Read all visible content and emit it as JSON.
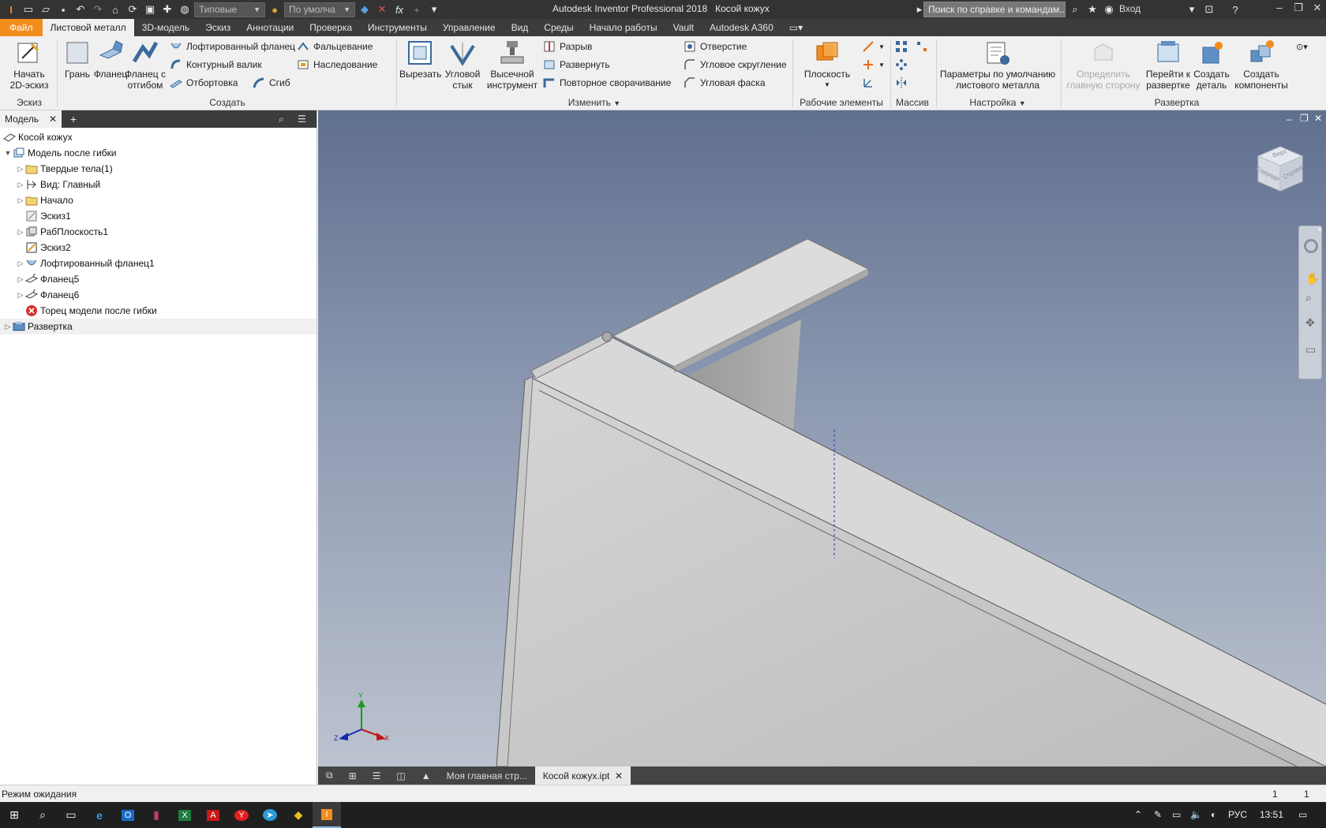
{
  "window": {
    "app_title": "Autodesk Inventor Professional 2018",
    "doc_title": "Косой кожух",
    "help_search_placeholder": "Поиск по справке и командам...",
    "signin": "Вход",
    "appearance_combo": "Типовые",
    "material_combo": "По умолча"
  },
  "tabs": [
    {
      "label": "Файл"
    },
    {
      "label": "Листовой металл"
    },
    {
      "label": "3D-модель"
    },
    {
      "label": "Эскиз"
    },
    {
      "label": "Аннотации"
    },
    {
      "label": "Проверка"
    },
    {
      "label": "Инструменты"
    },
    {
      "label": "Управление"
    },
    {
      "label": "Вид"
    },
    {
      "label": "Среды"
    },
    {
      "label": "Начало работы"
    },
    {
      "label": "Vault"
    },
    {
      "label": "Autodesk A360"
    }
  ],
  "ribbon": {
    "sketch": {
      "start_sketch_l1": "Начать",
      "start_sketch_l2": "2D-эскиз",
      "label": "Эскиз"
    },
    "create": {
      "face": "Грань",
      "flange": "Фланец",
      "contour_flange_l1": "Фланец с",
      "contour_flange_l2": "отгибом",
      "lofted_flange": "Лофтированный фланец",
      "contour_roll": "Контурный валик",
      "hem": "Отбортовка",
      "fold": "Фальцевание",
      "derive": "Наследование",
      "bend": "Сгиб",
      "label": "Создать"
    },
    "modify": {
      "cut": "Вырезать",
      "corner_seam_l1": "Угловой",
      "corner_seam_l2": "стык",
      "punch_l1": "Высечной",
      "punch_l2": "инструмент",
      "rip": "Разрыв",
      "unfold": "Развернуть",
      "refold": "Повторное сворачивание",
      "hole": "Отверстие",
      "corner_round": "Угловое скругление",
      "corner_chamfer": "Угловая фаска",
      "label": "Изменить"
    },
    "work_features": {
      "plane": "Плоскость",
      "label": "Рабочие элементы"
    },
    "pattern": {
      "label": "Массив"
    },
    "setup": {
      "defaults_l1": "Параметры по умолчанию",
      "defaults_l2": "листового металла",
      "label": "Настройка"
    },
    "flat_pattern": {
      "define_a_side_l1": "Определить",
      "define_a_side_l2": "главную сторону",
      "go_to_flat_l1": "Перейти к",
      "go_to_flat_l2": "развертке",
      "make_part_l1": "Создать",
      "make_part_l2": "деталь",
      "make_components_l1": "Создать",
      "make_components_l2": "компоненты",
      "label": "Развертка"
    }
  },
  "browser": {
    "tab_label": "Модель",
    "items": [
      {
        "label": "Косой кожух"
      },
      {
        "label": "Модель после гибки"
      },
      {
        "label": "Твердые тела(1)"
      },
      {
        "label": "Вид: Главный"
      },
      {
        "label": "Начало"
      },
      {
        "label": "Эскиз1"
      },
      {
        "label": "РабПлоскость1"
      },
      {
        "label": "Эскиз2"
      },
      {
        "label": "Лофтированный фланец1"
      },
      {
        "label": "Фланец5"
      },
      {
        "label": "Фланец6"
      },
      {
        "label": "Торец модели после гибки"
      },
      {
        "label": "Развертка"
      }
    ]
  },
  "viewcube": {
    "top": "Верх",
    "front": "Спереди",
    "right": "Справа"
  },
  "triad": {
    "x": "X",
    "y": "Y",
    "z": "Z"
  },
  "doc_tabs": [
    {
      "label": "Моя главная стр..."
    },
    {
      "label": "Косой кожух.ipt"
    }
  ],
  "status": {
    "text": "Режим ожидания",
    "count1": "1",
    "count2": "1"
  },
  "taskbar": {
    "lang": "РУС",
    "time": "13:51"
  },
  "colors": {
    "file_tab": "#f28c1d",
    "title_bar": "#333333",
    "ribbon_bg": "#f0f0f0"
  }
}
